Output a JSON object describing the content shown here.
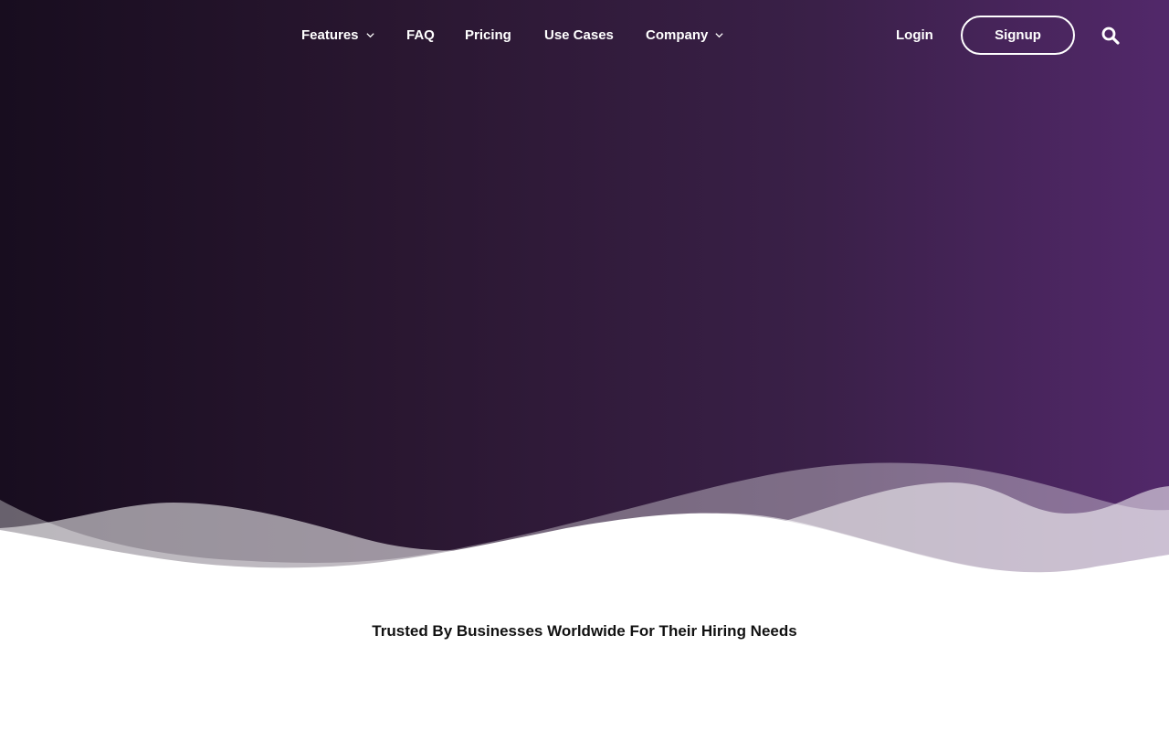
{
  "nav": {
    "items": [
      {
        "label": "Features",
        "has_dropdown": true
      },
      {
        "label": "FAQ",
        "has_dropdown": false
      },
      {
        "label": "Pricing",
        "has_dropdown": false
      },
      {
        "label": "Use Cases",
        "has_dropdown": false
      },
      {
        "label": "Company",
        "has_dropdown": true
      }
    ],
    "login_label": "Login",
    "signup_label": "Signup",
    "search_icon": "search-icon",
    "dropdown_icon": "chevron-down-icon"
  },
  "trusted": {
    "heading": "Trusted By Businesses Worldwide For Their Hiring Needs"
  },
  "colors": {
    "hero_start": "#180d1f",
    "hero_end": "#52286a",
    "nav_text": "#ffffff",
    "heading_text": "#111111"
  }
}
